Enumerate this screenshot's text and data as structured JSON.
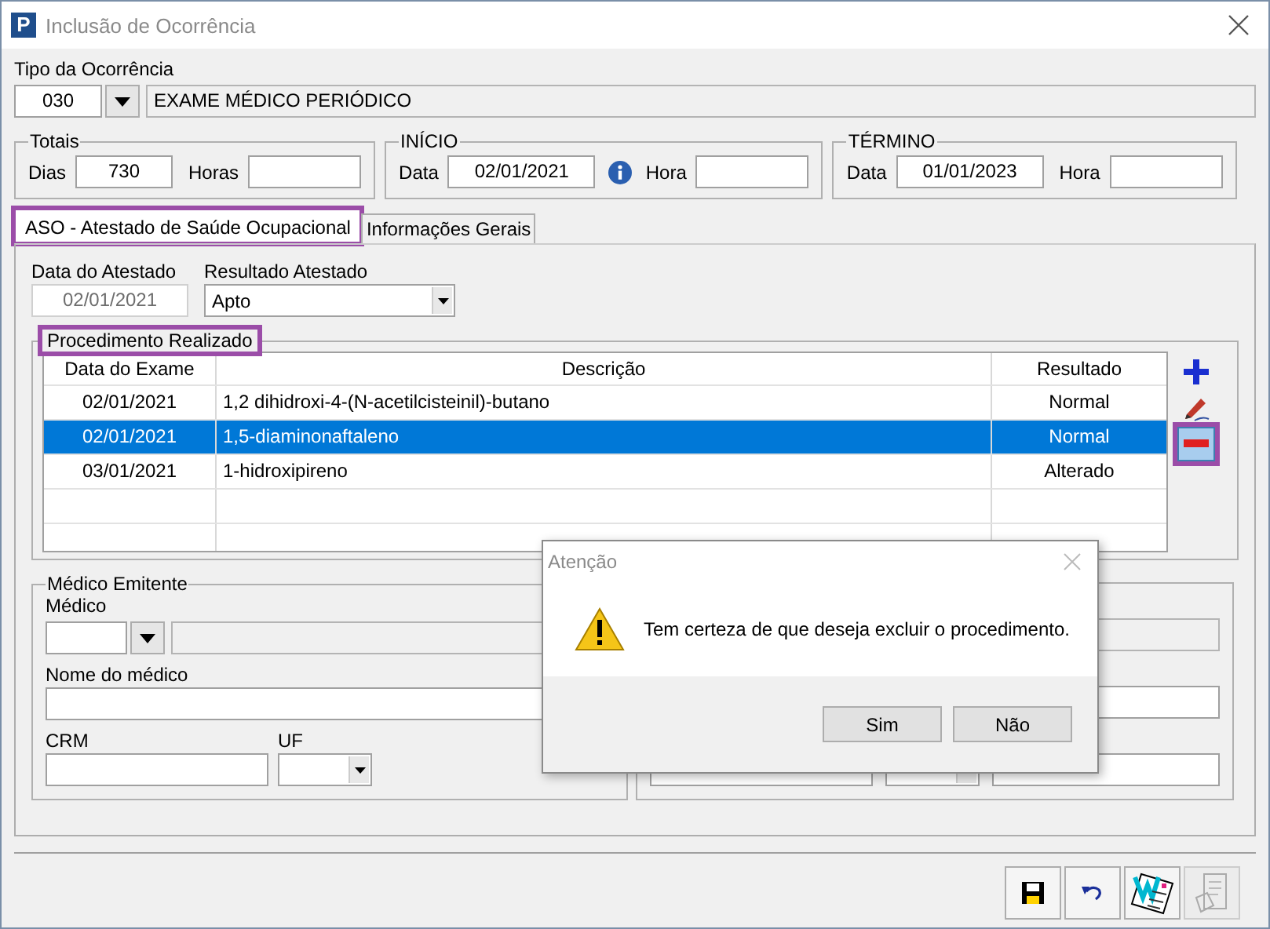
{
  "window": {
    "title": "Inclusão de Ocorrência",
    "logo": "P"
  },
  "tipo": {
    "label": "Tipo da Ocorrência",
    "code": "030",
    "description": "EXAME MÉDICO PERIÓDICO"
  },
  "totais": {
    "legend": "Totais",
    "dias_label": "Dias",
    "dias": "730",
    "horas_label": "Horas"
  },
  "inicio": {
    "legend": "INÍCIO",
    "data_label": "Data",
    "data": "02/01/2021",
    "hora_label": "Hora"
  },
  "termino": {
    "legend": "TÉRMINO",
    "data_label": "Data",
    "data": "01/01/2023",
    "hora_label": "Hora"
  },
  "tabs": [
    {
      "label": "ASO - Atestado de Saúde Ocupacional",
      "selected": true,
      "highlighted": true
    },
    {
      "label": "Informações Gerais",
      "selected": false,
      "highlighted": false
    }
  ],
  "aso": {
    "data_label": "Data do Atestado",
    "data": "02/01/2021",
    "resultado_label": "Resultado Atestado",
    "resultado": "Apto"
  },
  "procedimentos": {
    "legend": "Procedimento Realizado",
    "legend_highlighted": true,
    "columns": [
      "Data do Exame",
      "Descrição",
      "Resultado"
    ],
    "rows": [
      {
        "date": "02/01/2021",
        "description": "1,2 dihidroxi-4-(N-acetilcisteinil)-butano",
        "result": "Normal",
        "selected": false
      },
      {
        "date": "02/01/2021",
        "description": "1,5-diaminonaftaleno",
        "result": "Normal",
        "selected": true
      },
      {
        "date": "03/01/2021",
        "description": "1-hidroxipireno",
        "result": "Alterado",
        "selected": false
      }
    ]
  },
  "actions": [
    {
      "kind": "add",
      "highlighted": false
    },
    {
      "kind": "edit",
      "highlighted": false
    },
    {
      "kind": "remove",
      "highlighted": true
    }
  ],
  "medico": {
    "legend": "Médico Emitente",
    "medico_label": "Médico",
    "nome_label": "Nome do médico",
    "crm_label": "CRM",
    "uf_label": "UF"
  },
  "dialog": {
    "title": "Atenção",
    "message": "Tem certeza de que deseja excluir o procedimento.",
    "buttons": [
      "Sim",
      "Não"
    ]
  },
  "toolbar": [
    {
      "kind": "save",
      "disabled": false
    },
    {
      "kind": "undo",
      "disabled": false
    },
    {
      "kind": "document",
      "disabled": false
    },
    {
      "kind": "report",
      "disabled": true
    }
  ]
}
